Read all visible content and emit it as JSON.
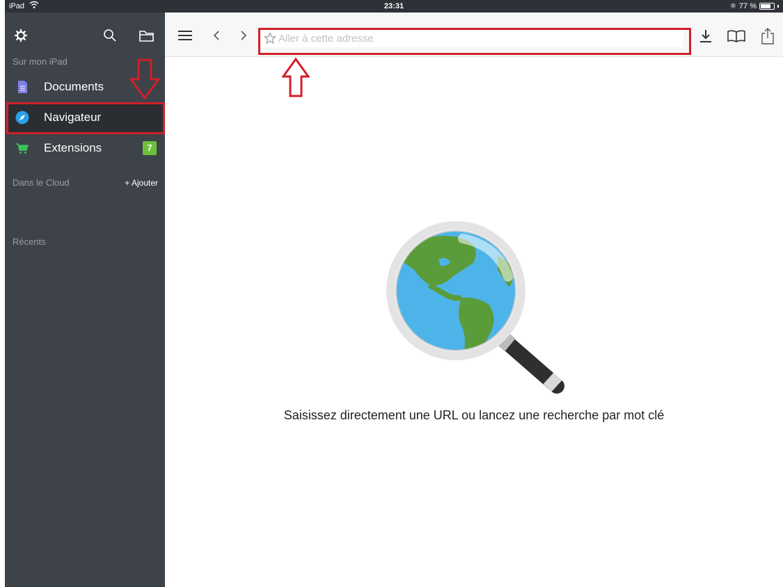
{
  "status_bar": {
    "device": "iPad",
    "time": "23:31",
    "battery_text": "77 %",
    "battery_level": 0.77
  },
  "sidebar": {
    "section_local": "Sur mon iPad",
    "items": [
      {
        "label": "Documents",
        "icon": "document-icon"
      },
      {
        "label": "Navigateur",
        "icon": "compass-icon"
      },
      {
        "label": "Extensions",
        "icon": "cart-icon",
        "badge": "7"
      }
    ],
    "section_cloud": "Dans le Cloud",
    "add_label": "+ Ajouter",
    "section_recent": "Récents"
  },
  "browser": {
    "url_placeholder": "Aller à cette adresse",
    "empty_hint": "Saisissez directement une URL ou lancez une recherche par mot clé"
  },
  "colors": {
    "sidebar_bg": "#3e4249",
    "annotation_red": "#d0202a",
    "badge_green": "#6dc13a",
    "compass_blue": "#2aa0e8",
    "document_purple": "#7f7fe6"
  }
}
